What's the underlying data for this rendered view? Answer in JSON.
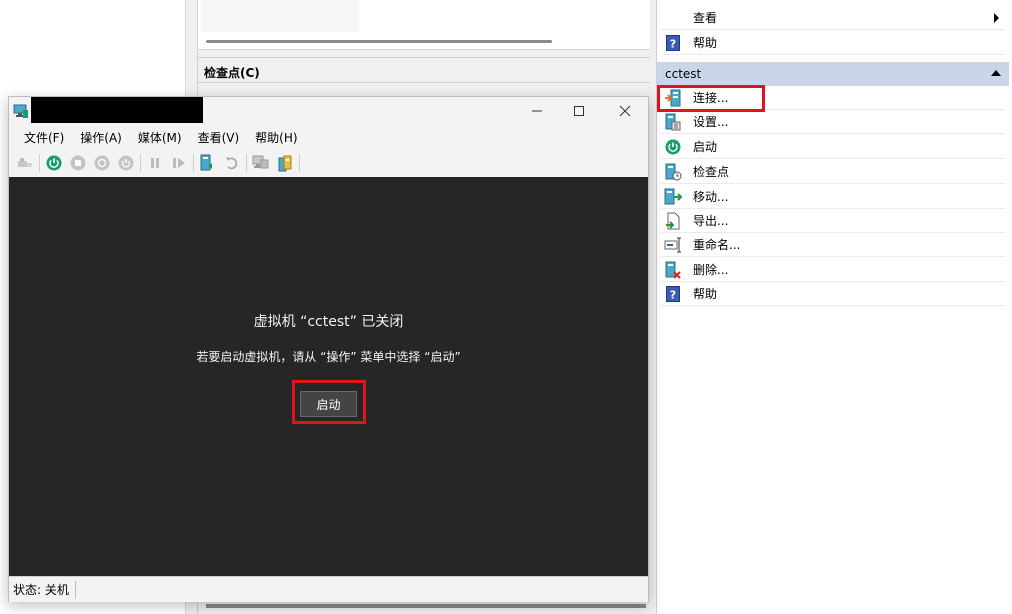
{
  "manager": {
    "checkpoints_header": "检查点(C)",
    "actions": {
      "top_items": [
        {
          "label": "查看",
          "icon": "view-icon",
          "has_submenu": true
        },
        {
          "label": "帮助",
          "icon": "help-icon"
        }
      ],
      "vm_section": {
        "title": "cctest",
        "items": [
          {
            "label": "连接...",
            "icon": "connect-icon"
          },
          {
            "label": "设置...",
            "icon": "settings-icon"
          },
          {
            "label": "启动",
            "icon": "power-icon"
          },
          {
            "label": "检查点",
            "icon": "checkpoint-icon"
          },
          {
            "label": "移动...",
            "icon": "move-icon"
          },
          {
            "label": "导出...",
            "icon": "export-icon"
          },
          {
            "label": "重命名...",
            "icon": "rename-icon"
          },
          {
            "label": "删除...",
            "icon": "delete-icon"
          },
          {
            "label": "帮助",
            "icon": "help-icon"
          }
        ]
      }
    }
  },
  "vm_window": {
    "menu": [
      "文件(F)",
      "操作(A)",
      "媒体(M)",
      "查看(V)",
      "帮助(H)"
    ],
    "screen": {
      "title": "虚拟机 “cctest” 已关闭",
      "subtitle": "若要启动虚拟机，请从 “操作” 菜单中选择 “启动”",
      "start_button": "启动"
    },
    "status": "状态: 关机"
  },
  "colors": {
    "highlight": "#e0141e",
    "section_header": "#c9d6e8",
    "vm_screen": "#262626"
  }
}
